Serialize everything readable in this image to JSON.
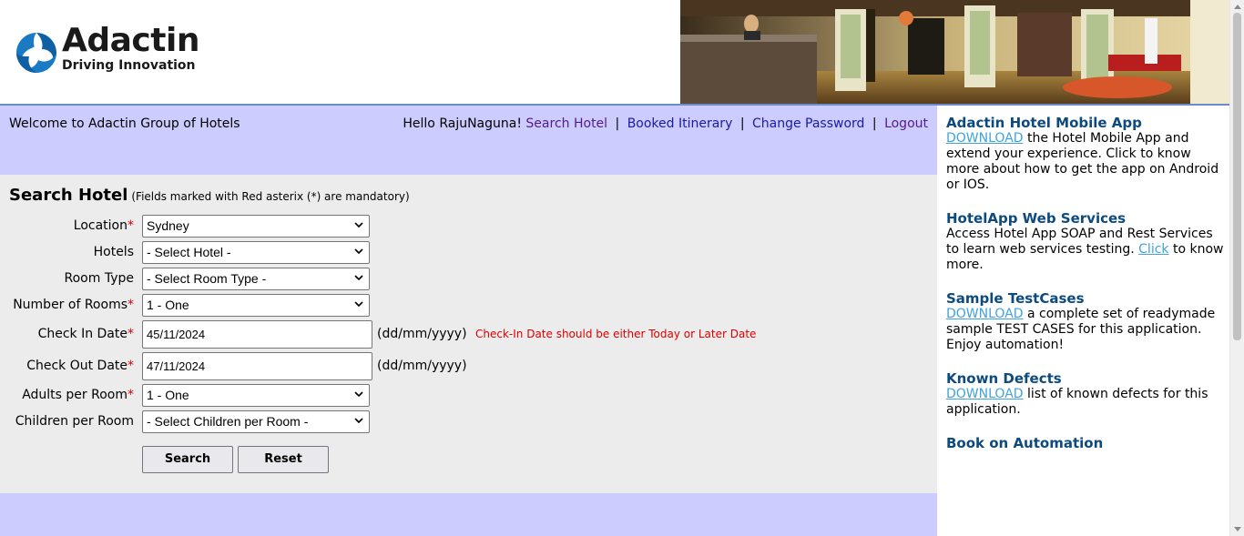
{
  "brand": {
    "name": "Adactin",
    "tagline": "Driving Innovation",
    "logo_icon": "adactin-swirl-logo",
    "accent_color": "#1a7bc4"
  },
  "banner": {
    "image": "hotel-lobby-photo"
  },
  "welcome_bar": {
    "welcome_text": "Welcome to Adactin Group of Hotels",
    "greeting": "Hello RajuNaguna!",
    "links": [
      "Search Hotel",
      "Booked Itinerary",
      "Change Password",
      "Logout"
    ],
    "separator": "|"
  },
  "form": {
    "title": "Search Hotel",
    "note": "(Fields marked with Red asterix (*) are mandatory)",
    "required_mark": "*",
    "location": {
      "label": "Location",
      "value": "Sydney"
    },
    "hotels": {
      "label": "Hotels",
      "value": "- Select Hotel -"
    },
    "room_type": {
      "label": "Room Type",
      "value": "- Select Room Type -"
    },
    "rooms": {
      "label": "Number of Rooms",
      "value": "1 - One"
    },
    "check_in": {
      "label": "Check In Date",
      "value": "45/11/2024",
      "format": "(dd/mm/yyyy)",
      "error": "Check-In Date should be either Today or Later Date"
    },
    "check_out": {
      "label": "Check Out Date",
      "value": "47/11/2024",
      "format": "(dd/mm/yyyy)"
    },
    "adults": {
      "label": "Adults per Room",
      "value": "1 - One"
    },
    "children": {
      "label": "Children per Room",
      "value": "- Select Children per Room -"
    },
    "search_button": "Search",
    "reset_button": "Reset",
    "error_color": "#e00000"
  },
  "sidebar": {
    "mobile_app": {
      "title": "Adactin Hotel Mobile App",
      "link": "DOWNLOAD",
      "text": " the Hotel Mobile App and extend your experience. Click to know more about how to get the app on Android or IOS."
    },
    "web_services": {
      "title": "HotelApp Web Services",
      "text_before": "Access Hotel App SOAP and Rest Services to learn web services testing. ",
      "link": "Click",
      "text_after": " to know more."
    },
    "test_cases": {
      "title": "Sample TestCases",
      "link": "DOWNLOAD",
      "text": " a complete set of readymade sample TEST CASES for this application. Enjoy automation!"
    },
    "known_defects": {
      "title": "Known Defects",
      "link": "DOWNLOAD",
      "text": " list of known defects for this application."
    },
    "book": {
      "title": "Book on Automation"
    }
  }
}
